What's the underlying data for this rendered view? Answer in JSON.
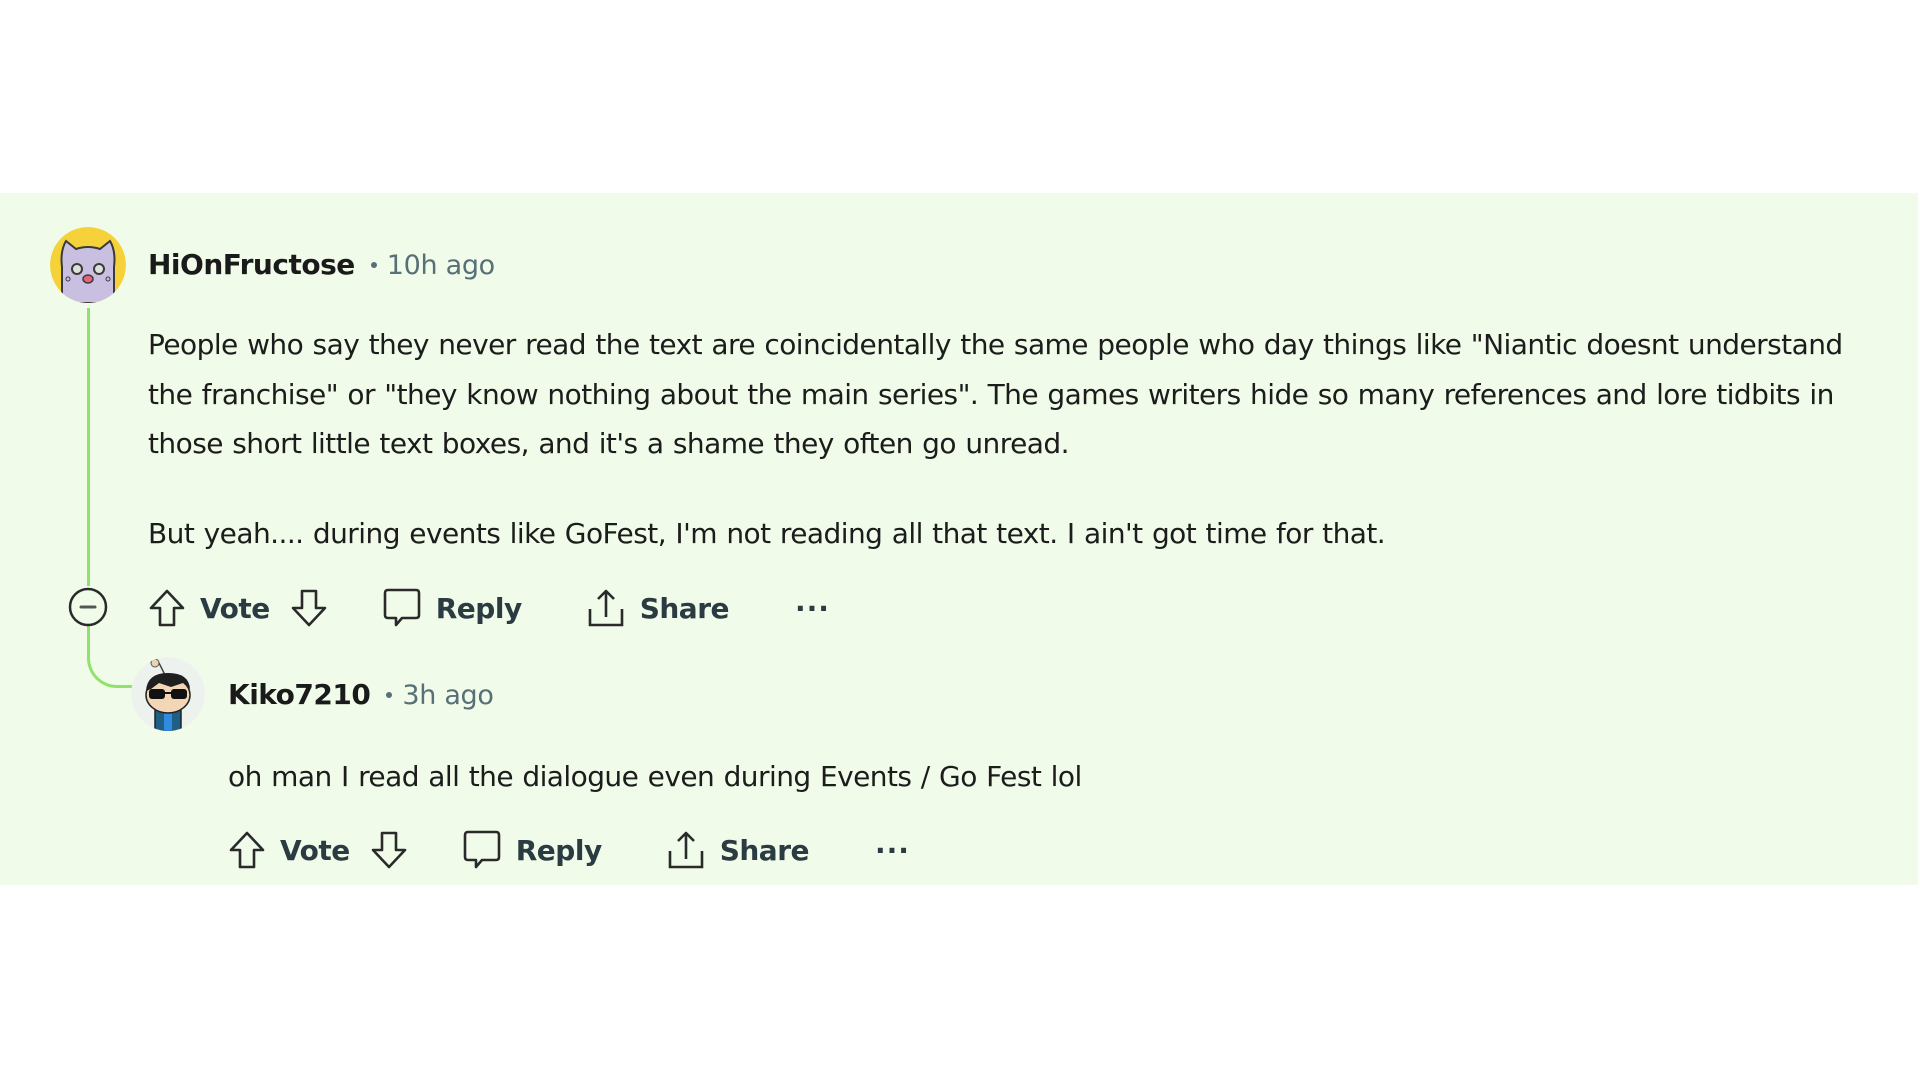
{
  "colors": {
    "thread_background": "#f0fbe9",
    "thread_line": "#8fe36a",
    "meta_text": "#576f76"
  },
  "comments": [
    {
      "username": "HiOnFructose",
      "time": "10h ago",
      "avatar_icon": "cat-avatar-icon",
      "paragraphs": [
        "People who say they never read the text are coincidentally the same people who day things like \"Niantic doesnt understand the franchise\" or \"they know nothing about the main series\". The games writers hide so many references and lore tidbits in those short little text boxes, and it's a shame they often go unread.",
        "But yeah.... during events like GoFest, I'm not reading all that text. I ain't got time for that."
      ],
      "actions": {
        "vote_label": "Vote",
        "reply_label": "Reply",
        "share_label": "Share",
        "more_label": "···"
      }
    },
    {
      "username": "Kiko7210",
      "time": "3h ago",
      "avatar_icon": "sunglasses-avatar-icon",
      "paragraphs": [
        "oh man I read all the dialogue even during Events / Go Fest lol"
      ],
      "actions": {
        "vote_label": "Vote",
        "reply_label": "Reply",
        "share_label": "Share",
        "more_label": "···"
      }
    }
  ]
}
